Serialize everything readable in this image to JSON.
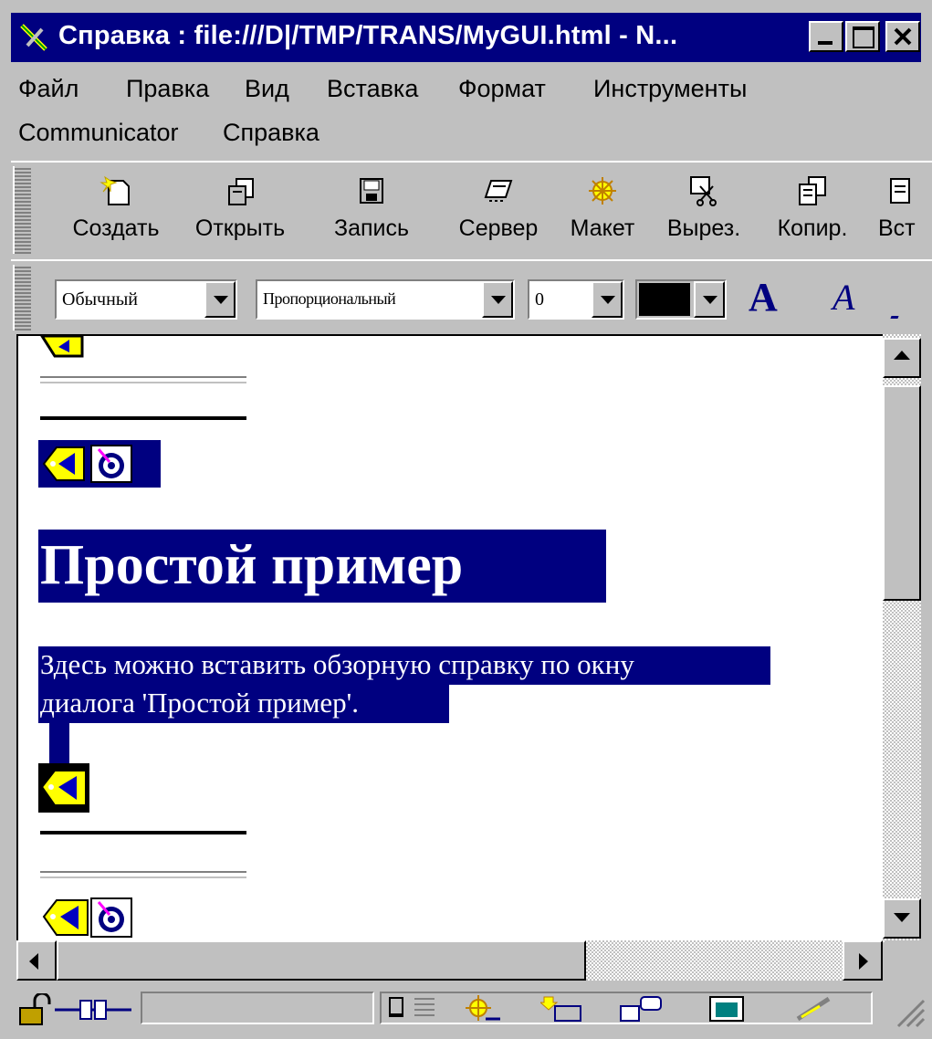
{
  "window": {
    "title": "Справка : file:///D|/TMP/TRANS/MyGUI.html - N..."
  },
  "menu": {
    "row1": [
      "Файл",
      "Правка",
      "Вид",
      "Вставка",
      "Формат",
      "Инструменты"
    ],
    "row2": [
      "Communicator",
      "Справка"
    ]
  },
  "toolbar": {
    "buttons": [
      {
        "label": "Создать",
        "icon": "new-document-icon"
      },
      {
        "label": "Открыть",
        "icon": "open-file-icon"
      },
      {
        "label": "Запись",
        "icon": "save-floppy-icon"
      },
      {
        "label": "Сервер",
        "icon": "publish-server-icon"
      },
      {
        "label": "Макет",
        "icon": "preview-layout-icon"
      },
      {
        "label": "Вырез.",
        "icon": "cut-scissors-icon"
      },
      {
        "label": "Копир.",
        "icon": "copy-icon"
      },
      {
        "label": "Вст",
        "icon": "paste-icon"
      }
    ]
  },
  "format_bar": {
    "paragraph_style": "Обычный",
    "font": "Пропорциональный",
    "size": "0",
    "color_value": "#000000",
    "font_size_large_glyph": "A",
    "font_size_small_glyph": "A"
  },
  "document": {
    "heading": "Простой пример",
    "paragraph_line1": "Здесь можно вставить обзорную справку по окну",
    "paragraph_line2": "диалога 'Простой пример'."
  },
  "colors": {
    "titlebar": "#000080",
    "selection": "#000080",
    "chrome": "#c0c0c0"
  }
}
